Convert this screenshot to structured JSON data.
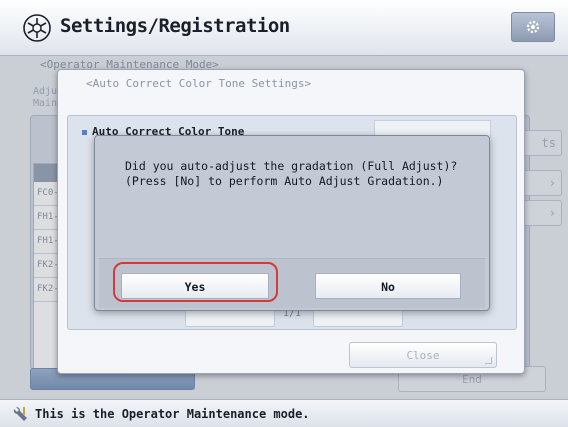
{
  "header": {
    "title": "Settings/Registration",
    "app_icon": "settings-registration-icon",
    "gear_icon": "gear-icon"
  },
  "background": {
    "mode_label": "<Operator Maintenance Mode>",
    "left_fragment_1": "Adju",
    "left_fragment_2": "Main",
    "list_rows": [
      "FC0-",
      "FH1-",
      "FH1-",
      "FK2-",
      "FK2-"
    ],
    "side_button_1": "ts",
    "end_button": "End"
  },
  "settings_dialog": {
    "title": "<Auto Correct Color Tone Settings>",
    "section_label": "Auto Correct Color Tone",
    "page_indicator": "1/1",
    "close_label": "Close"
  },
  "confirm_dialog": {
    "message_line1": "Did you auto-adjust the gradation (Full Adjust)?",
    "message_line2": "(Press [No] to perform Auto Adjust Gradation.)",
    "yes_label": "Yes",
    "no_label": "No",
    "highlight_color": "#d43a3a"
  },
  "status_bar": {
    "text": "This is the Operator Maintenance mode.",
    "icon": "wrench-icon"
  }
}
